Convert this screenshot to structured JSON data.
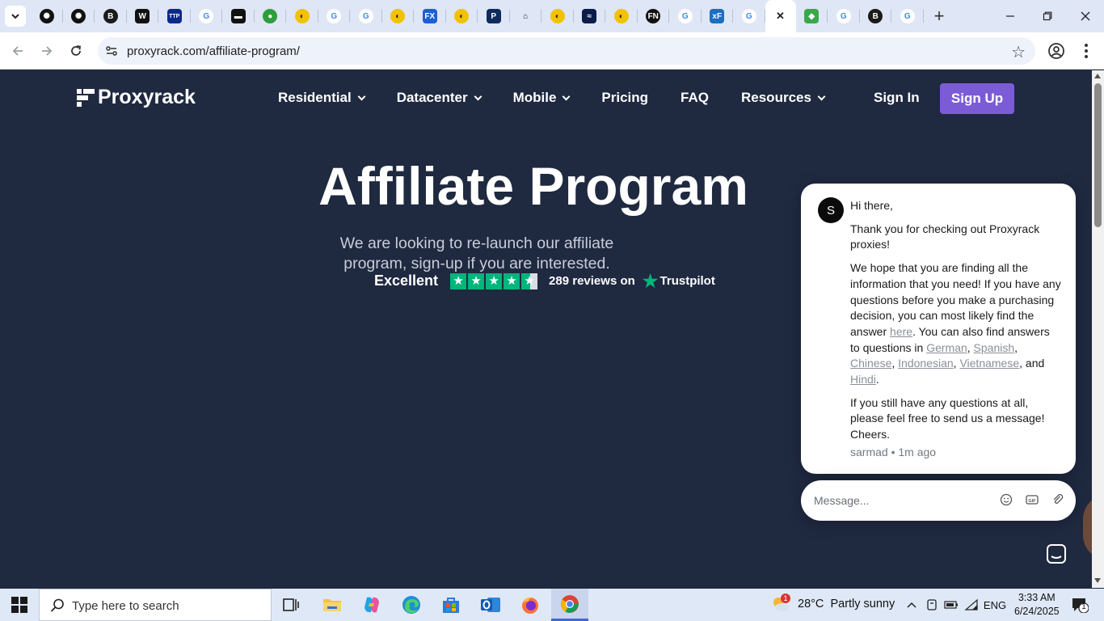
{
  "browser": {
    "tabs": [
      {
        "icon": "chatgpt-icon",
        "color": "#111111",
        "glyph": "✺",
        "round": true
      },
      {
        "icon": "chatgpt-icon",
        "color": "#111111",
        "glyph": "✺",
        "round": true
      },
      {
        "icon": "b-logo-icon",
        "color": "#1a1a1a",
        "glyph": "B",
        "round": true
      },
      {
        "icon": "w-logo-icon",
        "color": "#111111",
        "glyph": "W",
        "round": false
      },
      {
        "icon": "ttp-logo-icon",
        "color": "#0a2a8a",
        "glyph": "TTP",
        "round": false
      },
      {
        "icon": "google-icon",
        "color": "#ffffff",
        "glyph": "G",
        "round": true
      },
      {
        "icon": "film-logo-icon",
        "color": "#111111",
        "glyph": "▬",
        "round": false
      },
      {
        "icon": "green-globe-icon",
        "color": "#2e9e3a",
        "glyph": "●",
        "round": true
      },
      {
        "icon": "yellow-logo-icon",
        "color": "#f2c200",
        "glyph": "◐",
        "round": true
      },
      {
        "icon": "google-icon",
        "color": "#ffffff",
        "glyph": "G",
        "round": true
      },
      {
        "icon": "google-icon",
        "color": "#ffffff",
        "glyph": "G",
        "round": true
      },
      {
        "icon": "yellow-logo-icon",
        "color": "#f2c200",
        "glyph": "◐",
        "round": true
      },
      {
        "icon": "fx-logo-icon",
        "color": "#1b5fd6",
        "glyph": "FX",
        "round": false
      },
      {
        "icon": "yellow-logo-icon",
        "color": "#f2c200",
        "glyph": "◐",
        "round": true
      },
      {
        "icon": "p-logo-icon",
        "color": "#0f2a5c",
        "glyph": "P",
        "round": false
      },
      {
        "icon": "house-logo-icon",
        "color": "#dfe6f5",
        "glyph": "⌂",
        "round": false
      },
      {
        "icon": "yellow-logo-icon",
        "color": "#f2c200",
        "glyph": "◐",
        "round": true
      },
      {
        "icon": "wave-logo-icon",
        "color": "#0a1c4a",
        "glyph": "≈",
        "round": false
      },
      {
        "icon": "yellow-logo-icon",
        "color": "#f2c200",
        "glyph": "◐",
        "round": true
      },
      {
        "icon": "fn-logo-icon",
        "color": "#111111",
        "glyph": "FN",
        "round": true
      },
      {
        "icon": "google-icon",
        "color": "#ffffff",
        "glyph": "G",
        "round": true
      },
      {
        "icon": "xf-logo-icon",
        "color": "#1b6fc2",
        "glyph": "xF",
        "round": false
      },
      {
        "icon": "google-icon",
        "color": "#ffffff",
        "glyph": "G",
        "round": true
      },
      {
        "icon": "close-icon",
        "color": "#ffffff",
        "glyph": "✕",
        "round": false,
        "active": true
      },
      {
        "icon": "green-shield-icon",
        "color": "#3aa84a",
        "glyph": "◆",
        "round": false
      },
      {
        "icon": "google-icon",
        "color": "#ffffff",
        "glyph": "G",
        "round": true
      },
      {
        "icon": "b-logo-icon",
        "color": "#1a1a1a",
        "glyph": "B",
        "round": true
      },
      {
        "icon": "google-icon",
        "color": "#ffffff",
        "glyph": "G",
        "round": true
      }
    ],
    "url": "proxyrack.com/affiliate-program/"
  },
  "site": {
    "logo": "Proxyrack",
    "nav": [
      {
        "label": "Residential",
        "dropdown": true
      },
      {
        "label": "Datacenter",
        "dropdown": true
      },
      {
        "label": "Mobile",
        "dropdown": true
      },
      {
        "label": "Pricing",
        "dropdown": false
      },
      {
        "label": "FAQ",
        "dropdown": false
      },
      {
        "label": "Resources",
        "dropdown": true
      }
    ],
    "sign_in": "Sign In",
    "sign_up": "Sign Up",
    "accent": "#7b5cd6"
  },
  "hero": {
    "title": "Affiliate Program",
    "subtitle": "We are looking to re-launch our affiliate program, sign-up if you are interested.",
    "trust": {
      "rating_word": "Excellent",
      "stars": 4.5,
      "reviews": "289 reviews on",
      "brand": "Trustpilot",
      "brand_color": "#00b67a"
    }
  },
  "chat": {
    "avatar_letter": "S",
    "greeting": "Hi there,",
    "p1": "Thank you for checking out Proxyrack proxies!",
    "p2_pre": "We hope that you are finding all the information that you need! If you have any questions before you make a purchasing decision, you can most likely find the answer",
    "link_here": "here",
    "p2_mid": ". You can also find answers to questions in",
    "lang_links": [
      "German",
      "Spanish",
      "Chinese",
      "Indonesian",
      "Vietnamese",
      "Hindi"
    ],
    "sep": ",",
    "and": "and",
    "period": ".",
    "p3": "If you still have any questions at all, please feel free to send us a message! Cheers.",
    "meta": "sarmad • 1m ago",
    "input_placeholder": "Message..."
  },
  "taskbar": {
    "search_placeholder": "Type here to search",
    "weather": "28°C  Partly sunny",
    "weather_badge": "1",
    "lang": "ENG",
    "time": "3:33 AM",
    "date": "6/24/2025",
    "notif_count": "1"
  }
}
